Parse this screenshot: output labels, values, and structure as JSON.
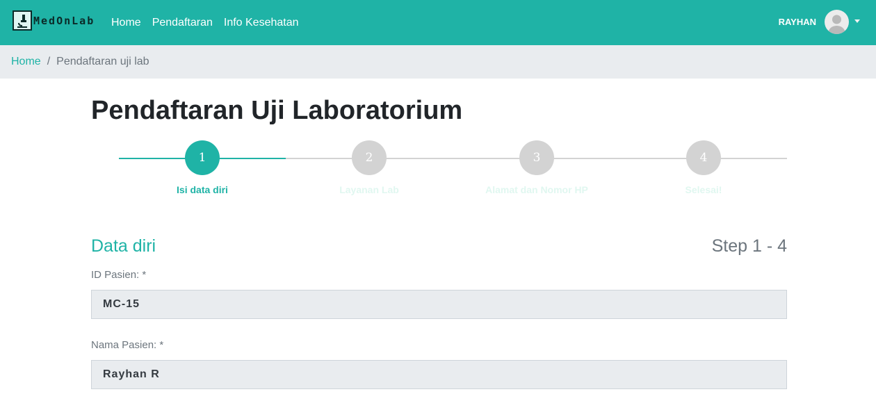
{
  "brand": {
    "name": "MedOnLab"
  },
  "nav": {
    "links": [
      "Home",
      "Pendaftaran",
      "Info Kesehatan"
    ]
  },
  "user": {
    "name": "RAYHAN"
  },
  "breadcrumb": {
    "home": "Home",
    "separator": "/",
    "current": "Pendaftaran uji lab"
  },
  "page": {
    "title": "Pendaftaran Uji Laboratorium"
  },
  "stepper": {
    "steps": [
      {
        "number": "1",
        "label": "Isi data diri",
        "active": true
      },
      {
        "number": "2",
        "label": "Layanan Lab",
        "active": false
      },
      {
        "number": "3",
        "label": "Alamat dan Nomor HP",
        "active": false
      },
      {
        "number": "4",
        "label": "Selesai!",
        "active": false
      }
    ]
  },
  "section": {
    "title": "Data diri",
    "step_count": "Step 1 - 4"
  },
  "form": {
    "patient_id": {
      "label": "ID Pasien: *",
      "value": "MC-15"
    },
    "patient_name": {
      "label": "Nama Pasien: *",
      "value": "Rayhan R"
    }
  },
  "colors": {
    "primary": "#1fb3a6",
    "inactive_circle": "#d3d3d3",
    "inactive_label": "#e0f7f0"
  }
}
